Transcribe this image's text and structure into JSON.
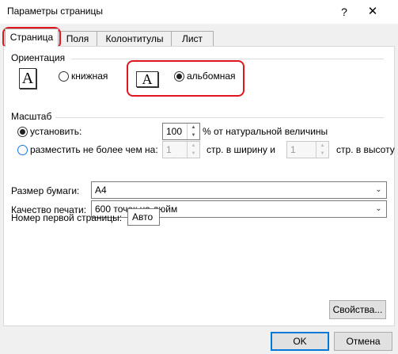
{
  "window": {
    "title": "Параметры страницы",
    "help_glyph": "?",
    "close_glyph": "✕"
  },
  "tabs": [
    {
      "label": "Страница",
      "active": true
    },
    {
      "label": "Поля",
      "active": false
    },
    {
      "label": "Колонтитулы",
      "active": false
    },
    {
      "label": "Лист",
      "active": false
    }
  ],
  "orientation": {
    "group_label": "Ориентация",
    "portrait_label": "книжная",
    "landscape_label": "альбомная",
    "selected": "landscape",
    "icon_glyph": "A"
  },
  "scale": {
    "group_label": "Масштаб",
    "set_label": "установить:",
    "set_value": "100",
    "set_suffix": "% от натуральной величины",
    "fit_label": "разместить не более чем на:",
    "fit_width_value": "1",
    "fit_width_suffix": "стр. в ширину и",
    "fit_height_value": "1",
    "fit_height_suffix": "стр. в высоту",
    "selected": "set"
  },
  "paper": {
    "size_label": "Размер бумаги:",
    "size_value": "A4",
    "quality_label": "Качество печати:",
    "quality_value": "600 точек на дюйм"
  },
  "first_page": {
    "label": "Номер первой страницы:",
    "value": "Авто"
  },
  "buttons": {
    "properties": "Свойства...",
    "ok": "OK",
    "cancel": "Отмена"
  },
  "colors": {
    "highlight": "#e0151f",
    "focus": "#0078d7"
  }
}
